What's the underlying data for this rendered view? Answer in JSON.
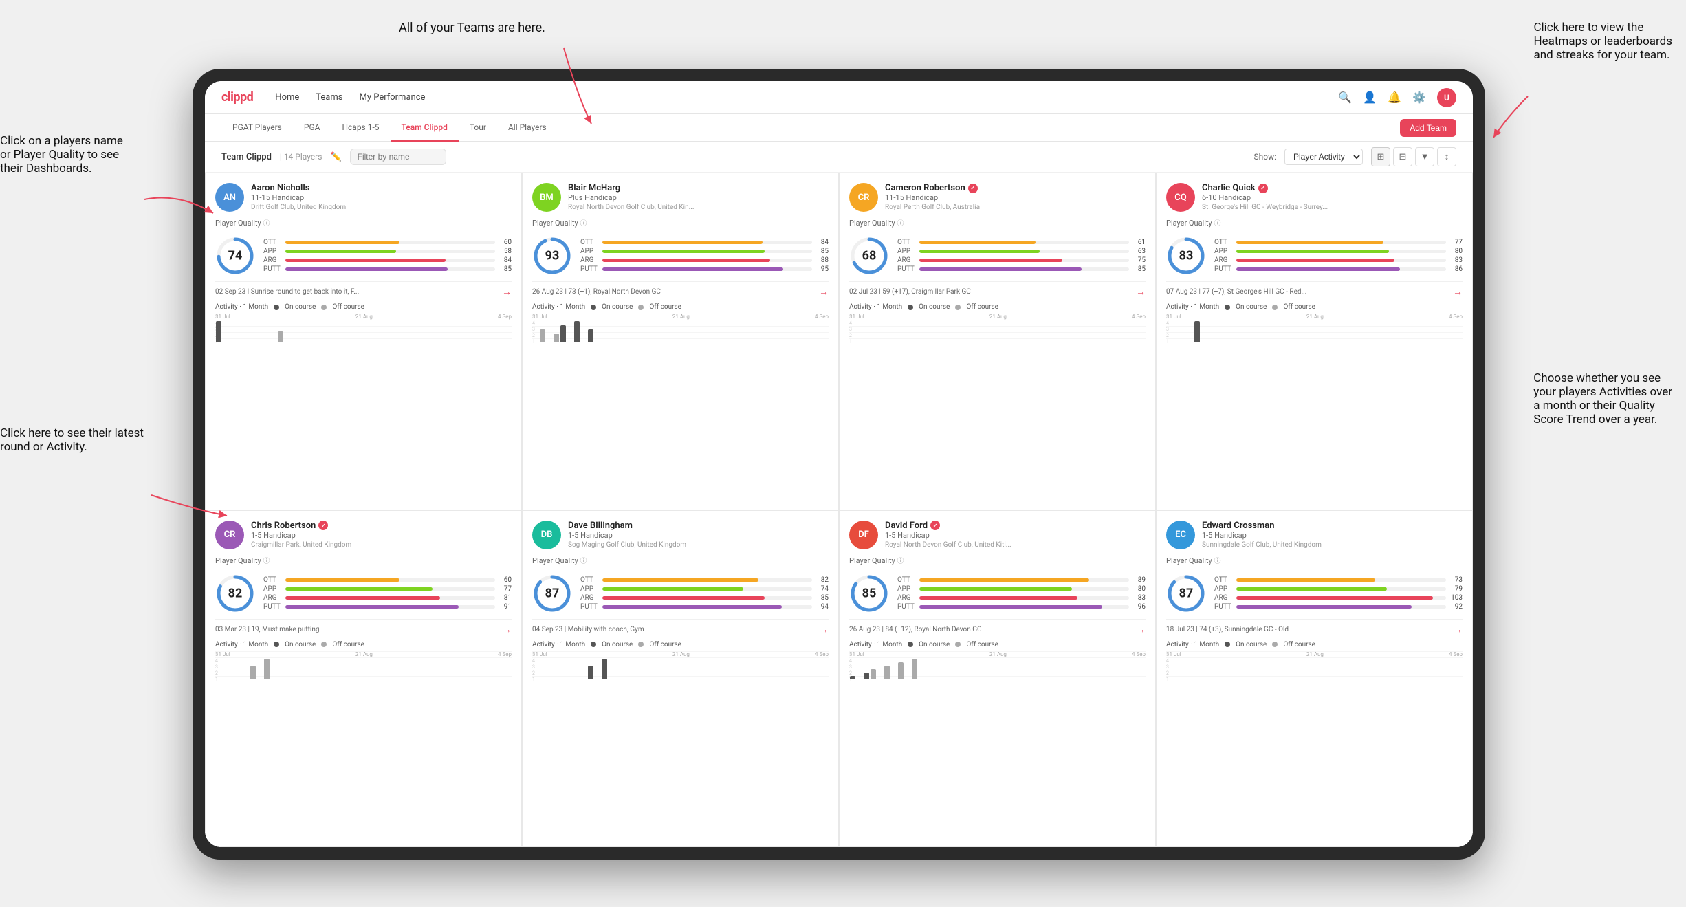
{
  "annotations": {
    "teams_tooltip": "All of your Teams are here.",
    "heatmaps_tooltip": "Click here to view the\nHeatmaps or leaderboards\nand streaks for your team.",
    "player_name_tooltip": "Click on a players name\nor Player Quality to see\ntheir Dashboards.",
    "latest_round_tooltip": "Click here to see their latest\nround or Activity.",
    "activity_tooltip": "Choose whether you see\nyour players Activities over\na month or their Quality\nScore Trend over a year."
  },
  "nav": {
    "logo": "clippd",
    "links": [
      "Home",
      "Teams",
      "My Performance"
    ],
    "icons": [
      "search",
      "user",
      "bell",
      "settings",
      "avatar"
    ]
  },
  "sub_nav": {
    "tabs": [
      "PGAT Players",
      "PGA",
      "Hcaps 1-5",
      "Team Clippd",
      "Tour",
      "All Players"
    ],
    "active_tab": "Team Clippd",
    "add_team_label": "Add Team"
  },
  "team_bar": {
    "title": "Team Clippd",
    "separator": "|",
    "count": "14 Players",
    "search_placeholder": "Filter by name",
    "show_label": "Show:",
    "show_value": "Player Activity",
    "view_options": [
      "grid-2",
      "grid-3",
      "filter",
      "sort"
    ]
  },
  "players": [
    {
      "name": "Aaron Nicholls",
      "handicap": "11-15 Handicap",
      "club": "Drift Golf Club, United Kingdom",
      "verified": false,
      "quality": 74,
      "quality_color": "#4a90d9",
      "stats": [
        {
          "label": "OTT",
          "value": 60,
          "color": "#f5a623"
        },
        {
          "label": "APP",
          "value": 58,
          "color": "#7ed321"
        },
        {
          "label": "ARG",
          "value": 84,
          "color": "#e8445a"
        },
        {
          "label": "PUTT",
          "value": 85,
          "color": "#9b59b6"
        }
      ],
      "latest": "02 Sep 23 | Sunrise round to get back into it, F...",
      "activity_bars": [
        2,
        0,
        0,
        0,
        0,
        0,
        0,
        0,
        0,
        1,
        0
      ],
      "chart_labels": [
        "31 Jul",
        "21 Aug",
        "4 Sep"
      ]
    },
    {
      "name": "Blair McHarg",
      "handicap": "Plus Handicap",
      "club": "Royal North Devon Golf Club, United Kin...",
      "verified": false,
      "quality": 93,
      "quality_color": "#4a90d9",
      "stats": [
        {
          "label": "OTT",
          "value": 84,
          "color": "#f5a623"
        },
        {
          "label": "APP",
          "value": 85,
          "color": "#7ed321"
        },
        {
          "label": "ARG",
          "value": 88,
          "color": "#e8445a"
        },
        {
          "label": "PUTT",
          "value": 95,
          "color": "#9b59b6"
        }
      ],
      "latest": "26 Aug 23 | 73 (+1), Royal North Devon GC",
      "activity_bars": [
        0,
        3,
        0,
        2,
        4,
        0,
        5,
        0,
        3,
        0,
        0
      ],
      "chart_labels": [
        "31 Jul",
        "21 Aug",
        "4 Sep"
      ]
    },
    {
      "name": "Cameron Robertson",
      "handicap": "11-15 Handicap",
      "club": "Royal Perth Golf Club, Australia",
      "verified": true,
      "quality": 68,
      "quality_color": "#4a90d9",
      "stats": [
        {
          "label": "OTT",
          "value": 61,
          "color": "#f5a623"
        },
        {
          "label": "APP",
          "value": 63,
          "color": "#7ed321"
        },
        {
          "label": "ARG",
          "value": 75,
          "color": "#e8445a"
        },
        {
          "label": "PUTT",
          "value": 85,
          "color": "#9b59b6"
        }
      ],
      "latest": "02 Jul 23 | 59 (+17), Craigmillar Park GC",
      "activity_bars": [
        0,
        0,
        0,
        0,
        0,
        0,
        0,
        0,
        0,
        0,
        0
      ],
      "chart_labels": [
        "31 Jul",
        "21 Aug",
        "4 Sep"
      ]
    },
    {
      "name": "Charlie Quick",
      "handicap": "6-10 Handicap",
      "club": "St. George's Hill GC - Weybridge - Surrey...",
      "verified": true,
      "quality": 83,
      "quality_color": "#4a90d9",
      "stats": [
        {
          "label": "OTT",
          "value": 77,
          "color": "#f5a623"
        },
        {
          "label": "APP",
          "value": 80,
          "color": "#7ed321"
        },
        {
          "label": "ARG",
          "value": 83,
          "color": "#e8445a"
        },
        {
          "label": "PUTT",
          "value": 86,
          "color": "#9b59b6"
        }
      ],
      "latest": "07 Aug 23 | 77 (+7), St George's Hill GC - Red...",
      "activity_bars": [
        0,
        0,
        0,
        0,
        1,
        0,
        0,
        0,
        0,
        0,
        0
      ],
      "chart_labels": [
        "31 Jul",
        "21 Aug",
        "4 Sep"
      ]
    },
    {
      "name": "Chris Robertson",
      "handicap": "1-5 Handicap",
      "club": "Craigmillar Park, United Kingdom",
      "verified": true,
      "quality": 82,
      "quality_color": "#4a90d9",
      "stats": [
        {
          "label": "OTT",
          "value": 60,
          "color": "#f5a623"
        },
        {
          "label": "APP",
          "value": 77,
          "color": "#7ed321"
        },
        {
          "label": "ARG",
          "value": 81,
          "color": "#e8445a"
        },
        {
          "label": "PUTT",
          "value": 91,
          "color": "#9b59b6"
        }
      ],
      "latest": "03 Mar 23 | 19, Must make putting",
      "activity_bars": [
        0,
        0,
        0,
        0,
        0,
        2,
        0,
        3,
        0,
        0,
        0
      ],
      "chart_labels": [
        "31 Jul",
        "21 Aug",
        "4 Sep"
      ]
    },
    {
      "name": "Dave Billingham",
      "handicap": "1-5 Handicap",
      "club": "Sog Maging Golf Club, United Kingdom",
      "verified": false,
      "quality": 87,
      "quality_color": "#4a90d9",
      "stats": [
        {
          "label": "OTT",
          "value": 82,
          "color": "#f5a623"
        },
        {
          "label": "APP",
          "value": 74,
          "color": "#7ed321"
        },
        {
          "label": "ARG",
          "value": 85,
          "color": "#e8445a"
        },
        {
          "label": "PUTT",
          "value": 94,
          "color": "#9b59b6"
        }
      ],
      "latest": "04 Sep 23 | Mobility with coach, Gym",
      "activity_bars": [
        0,
        0,
        0,
        0,
        0,
        0,
        0,
        0,
        2,
        0,
        3
      ],
      "chart_labels": [
        "31 Jul",
        "21 Aug",
        "4 Sep"
      ]
    },
    {
      "name": "David Ford",
      "handicap": "1-5 Handicap",
      "club": "Royal North Devon Golf Club, United Kiti...",
      "verified": true,
      "quality": 85,
      "quality_color": "#4a90d9",
      "stats": [
        {
          "label": "OTT",
          "value": 89,
          "color": "#f5a623"
        },
        {
          "label": "APP",
          "value": 80,
          "color": "#7ed321"
        },
        {
          "label": "ARG",
          "value": 83,
          "color": "#e8445a"
        },
        {
          "label": "PUTT",
          "value": 96,
          "color": "#9b59b6"
        }
      ],
      "latest": "26 Aug 23 | 84 (+12), Royal North Devon GC",
      "activity_bars": [
        1,
        0,
        2,
        3,
        0,
        4,
        0,
        5,
        0,
        6,
        0
      ],
      "chart_labels": [
        "31 Jul",
        "21 Aug",
        "4 Sep"
      ]
    },
    {
      "name": "Edward Crossman",
      "handicap": "1-5 Handicap",
      "club": "Sunningdale Golf Club, United Kingdom",
      "verified": false,
      "quality": 87,
      "quality_color": "#4a90d9",
      "stats": [
        {
          "label": "OTT",
          "value": 73,
          "color": "#f5a623"
        },
        {
          "label": "APP",
          "value": 79,
          "color": "#7ed321"
        },
        {
          "label": "ARG",
          "value": 103,
          "color": "#e8445a"
        },
        {
          "label": "PUTT",
          "value": 92,
          "color": "#9b59b6"
        }
      ],
      "latest": "18 Jul 23 | 74 (+3), Sunningdale GC - Old",
      "activity_bars": [
        0,
        0,
        0,
        0,
        0,
        0,
        0,
        0,
        0,
        0,
        0
      ],
      "chart_labels": [
        "31 Jul",
        "21 Aug",
        "4 Sep"
      ]
    }
  ],
  "activity_legend": {
    "label": "Activity · 1 Month",
    "on_course": "On course",
    "off_course": "Off course",
    "on_color": "#555",
    "off_color": "#aaa"
  }
}
